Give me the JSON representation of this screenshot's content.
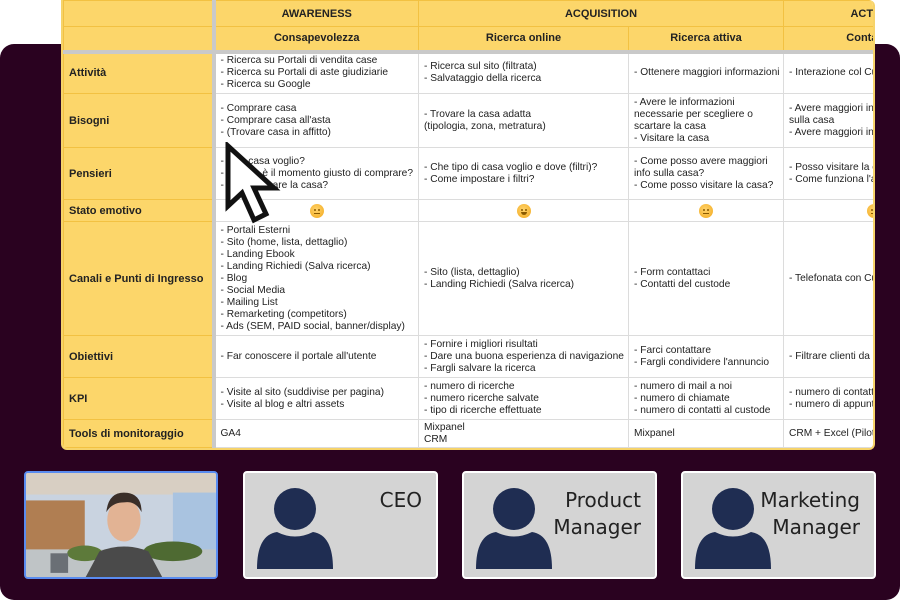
{
  "spreadsheet": {
    "stages": [
      "",
      "AWARENESS",
      "ACQUISITION",
      "ACTIVAT"
    ],
    "phases": [
      "",
      "Consapevolezza",
      "Ricerca online",
      "Ricerca attiva",
      "Contatto c"
    ],
    "rows": [
      {
        "label": "Attività",
        "cells": [
          [
            "- Ricerca su Portali di vendita case",
            "- Ricerca su Portali di aste giudiziarie",
            "- Ricerca su Google"
          ],
          [
            "- Ricerca sul sito (filtrata)",
            "- Salvataggio della ricerca"
          ],
          [
            "- Ottenere maggiori informazioni"
          ],
          [
            "- Interazione col Cu"
          ]
        ]
      },
      {
        "label": "Bisogni",
        "cells": [
          [
            "- Comprare casa",
            "- Comprare casa all'asta",
            "- (Trovare casa in affitto)"
          ],
          [
            "- Trovare la casa adatta",
            "(tipologia, zona, metratura)"
          ],
          [
            "- Avere le informazioni",
            "necessarie per scegliere o",
            "scartare la casa",
            "- Visitare la casa"
          ],
          [
            "- Avere maggiori in",
            "sulla casa",
            "- Avere maggiori in"
          ]
        ]
      },
      {
        "label": "Pensieri",
        "cells": [
          [
            "- Che casa voglio?",
            "- Questo è il momento giusto di comprare?",
            "- Dove cercare la casa?"
          ],
          [
            "- Che tipo di casa voglio e dove (filtri)?",
            "- Come impostare i filtri?"
          ],
          [
            "- Come posso avere maggiori",
            "info sulla casa?",
            "- Come posso visitare la casa?"
          ],
          [
            "- Posso visitare la c",
            "- Come funziona l'a"
          ]
        ]
      },
      {
        "label": "Stato emotivo",
        "emotions": [
          "neutral",
          "happy",
          "neutral",
          "neutral"
        ]
      },
      {
        "label": "Canali e Punti di Ingresso",
        "cells": [
          [
            "- Portali Esterni",
            "- Sito (home, lista, dettaglio)",
            "- Landing Ebook",
            "- Landing Richiedi (Salva ricerca)",
            "- Blog",
            "- Social Media",
            "- Mailing List",
            "- Remarketing (competitors)",
            "- Ads (SEM, PAID social, banner/display)"
          ],
          [
            "- Sito (lista, dettaglio)",
            "- Landing Richiedi (Salva ricerca)"
          ],
          [
            "- Form contattaci",
            "- Contatti del custode"
          ],
          [
            "- Telefonata con Cu"
          ]
        ]
      },
      {
        "label": "Obiettivi",
        "cells": [
          [
            "- Far conoscere il portale all'utente"
          ],
          [
            "- Fornire i migliori risultati",
            "- Dare una buona esperienza di navigazione",
            "- Fargli salvare la ricerca"
          ],
          [
            "- Farci contattare",
            "- Fargli condividere l'annuncio"
          ],
          [
            "- Filtrare clienti da p"
          ]
        ]
      },
      {
        "label": "KPI",
        "cells": [
          [
            "- Visite al sito (suddivise per pagina)",
            "- Visite al blog e altri assets"
          ],
          [
            "- numero di ricerche",
            "- numero ricerche salvate",
            "- tipo di ricerche effettuate"
          ],
          [
            "- numero di mail a noi",
            "- numero di chiamate",
            "- numero di contatti al custode"
          ],
          [
            "- numero di contatti",
            "- numero di appunt"
          ]
        ]
      },
      {
        "label": "Tools di monitoraggio",
        "cells": [
          [
            "GA4"
          ],
          [
            "Mixpanel",
            "CRM"
          ],
          [
            "Mixpanel"
          ],
          [
            "CRM + Excel (Pilot"
          ]
        ]
      }
    ]
  },
  "participants": [
    {
      "name": "",
      "type": "video"
    },
    {
      "name": "CEO",
      "type": "avatar"
    },
    {
      "name": "Product Manager",
      "lines": [
        "Product",
        "Manager"
      ],
      "type": "avatar"
    },
    {
      "name": "Marketing Manager",
      "lines": [
        "Marketing",
        "Manager"
      ],
      "type": "avatar"
    }
  ],
  "colors": {
    "header_yellow": "#fcd66a",
    "meeting_bg": "#2a0220",
    "avatar_navy": "#1f2d52",
    "tile_gray": "#d4d4d4",
    "active_speaker_border": "#5a8cf0"
  }
}
